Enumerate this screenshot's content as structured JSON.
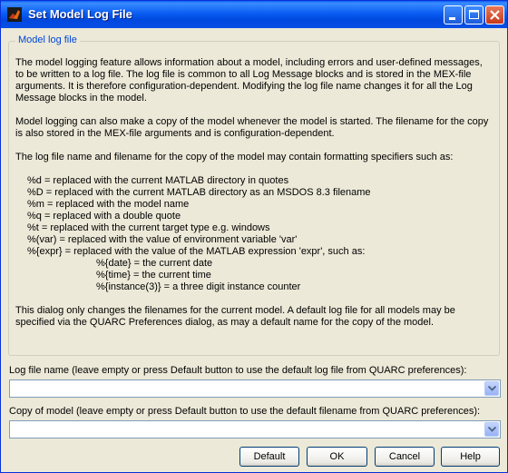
{
  "window": {
    "title": "Set Model Log File",
    "icon": "matlab-icon",
    "controls": [
      "minimize-icon",
      "maximize-icon",
      "close-icon"
    ]
  },
  "group": {
    "legend": "Model log file",
    "paragraph1": "The model logging feature allows information about a model, including errors and user-defined messages, to be written to a log file. The log file is common to all Log Message blocks and is stored in the MEX-file arguments. It is therefore configuration-dependent. Modifying the log file name changes it for all the Log Message blocks in the model.",
    "paragraph2": "Model logging can also make a copy of the model whenever the model is started. The filename for the copy is also stored in the MEX-file arguments and is configuration-dependent.",
    "paragraph3": "The log file name and filename for the copy of the model may contain formatting specifiers such as:",
    "specifiers": [
      "%d = replaced with the current MATLAB directory in quotes",
      "%D = replaced with the current MATLAB directory as an MSDOS 8.3 filename",
      "%m = replaced with the model name",
      "%q = replaced with a double quote",
      "%t = replaced with the current target type e.g. windows",
      "%(var) = replaced with the value of environment variable 'var'",
      "%{expr} = replaced with the value of the MATLAB expression 'expr', such as:"
    ],
    "subspecifiers": [
      "%{date} = the current date",
      "%{time} = the current time",
      "%{instance(3)} = a three digit instance counter"
    ],
    "paragraph4": "This dialog only changes the filenames for the current model. A default log file for all models may be specified via the QUARC Preferences dialog, as may a default name for the copy of the model."
  },
  "log_file": {
    "label": "Log file name (leave empty or press Default button to use the default log file from QUARC preferences):",
    "value": ""
  },
  "copy_model": {
    "label": "Copy of model (leave empty or press Default button to use the default filename from QUARC preferences):",
    "value": ""
  },
  "buttons": {
    "default": "Default",
    "ok": "OK",
    "cancel": "Cancel",
    "help": "Help"
  },
  "colors": {
    "title_bar": "#0a5ef2",
    "dialog_bg": "#ece9d8",
    "legend_text": "#0046d5"
  }
}
